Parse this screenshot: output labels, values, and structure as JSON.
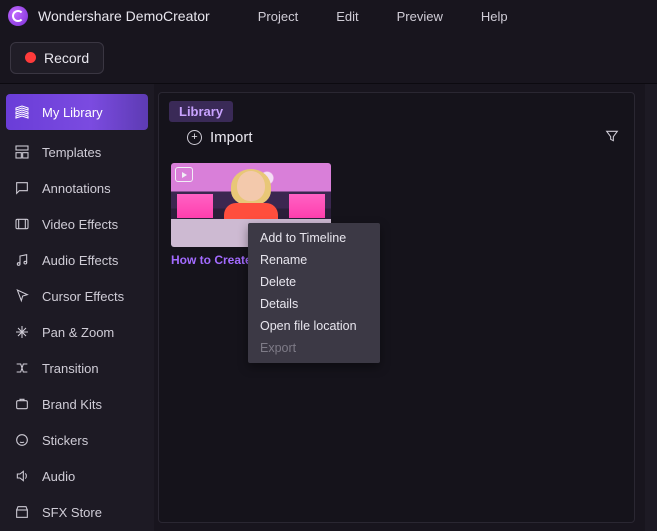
{
  "app": {
    "title": "Wondershare DemoCreator"
  },
  "menu": [
    "Project",
    "Edit",
    "Preview",
    "Help"
  ],
  "toolbar": {
    "record_label": "Record"
  },
  "sidebar": {
    "items": [
      {
        "label": "My Library",
        "icon": "library",
        "active": true
      },
      {
        "label": "Templates",
        "icon": "templates"
      },
      {
        "label": "Annotations",
        "icon": "annotations"
      },
      {
        "label": "Video Effects",
        "icon": "video-effects"
      },
      {
        "label": "Audio Effects",
        "icon": "audio-effects"
      },
      {
        "label": "Cursor Effects",
        "icon": "cursor-effects"
      },
      {
        "label": "Pan & Zoom",
        "icon": "pan-zoom"
      },
      {
        "label": "Transition",
        "icon": "transition"
      },
      {
        "label": "Brand Kits",
        "icon": "brand-kits"
      },
      {
        "label": "Stickers",
        "icon": "stickers"
      },
      {
        "label": "Audio",
        "icon": "audio"
      },
      {
        "label": "SFX Store",
        "icon": "sfx-store"
      }
    ]
  },
  "panel": {
    "tabs": [
      {
        "label": "Library",
        "active": true
      }
    ],
    "import_label": "Import",
    "clips": [
      {
        "title": "How to Create"
      }
    ],
    "context_menu": [
      {
        "label": "Add to Timeline",
        "enabled": true
      },
      {
        "label": "Rename",
        "enabled": true
      },
      {
        "label": "Delete",
        "enabled": true
      },
      {
        "label": "Details",
        "enabled": true
      },
      {
        "label": "Open file location",
        "enabled": true
      },
      {
        "label": "Export",
        "enabled": false
      }
    ]
  },
  "colors": {
    "accent": "#7b4be0",
    "link": "#a36bff"
  }
}
